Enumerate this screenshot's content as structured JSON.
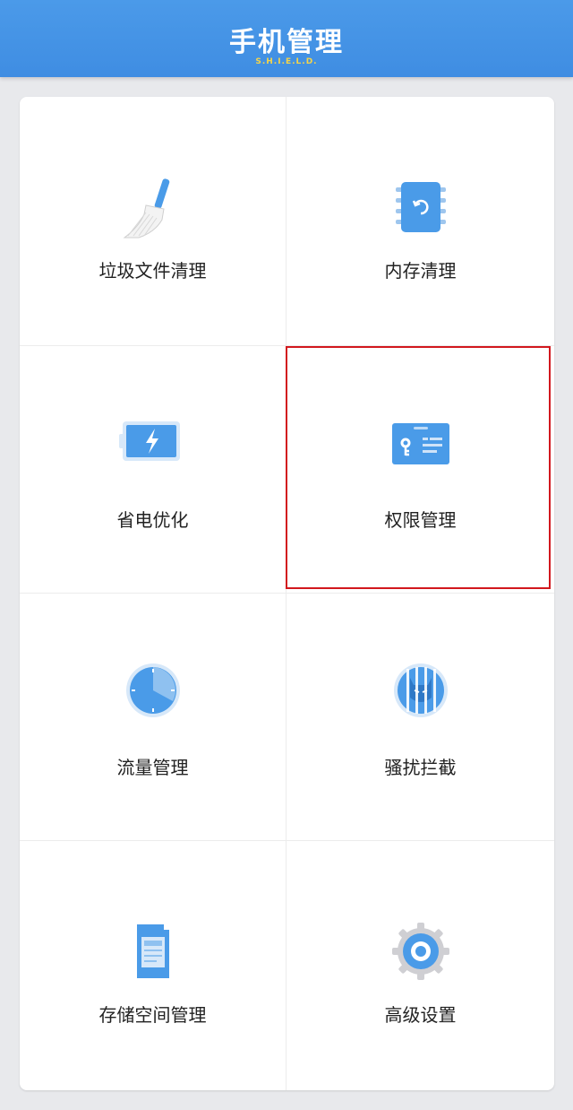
{
  "header": {
    "title": "手机管理",
    "subtitle": "S.H.I.E.L.D."
  },
  "tiles": [
    {
      "label": "垃圾文件清理",
      "icon": "broom-icon"
    },
    {
      "label": "内存清理",
      "icon": "memory-icon"
    },
    {
      "label": "省电优化",
      "icon": "battery-icon"
    },
    {
      "label": "权限管理",
      "icon": "permission-card-icon"
    },
    {
      "label": "流量管理",
      "icon": "data-clock-icon"
    },
    {
      "label": "骚扰拦截",
      "icon": "harass-block-icon"
    },
    {
      "label": "存储空间管理",
      "icon": "sd-card-icon"
    },
    {
      "label": "高级设置",
      "icon": "gear-icon"
    }
  ],
  "colors": {
    "header": "#4193e4",
    "accent": "#4a9be8",
    "highlight": "#d2181e"
  }
}
